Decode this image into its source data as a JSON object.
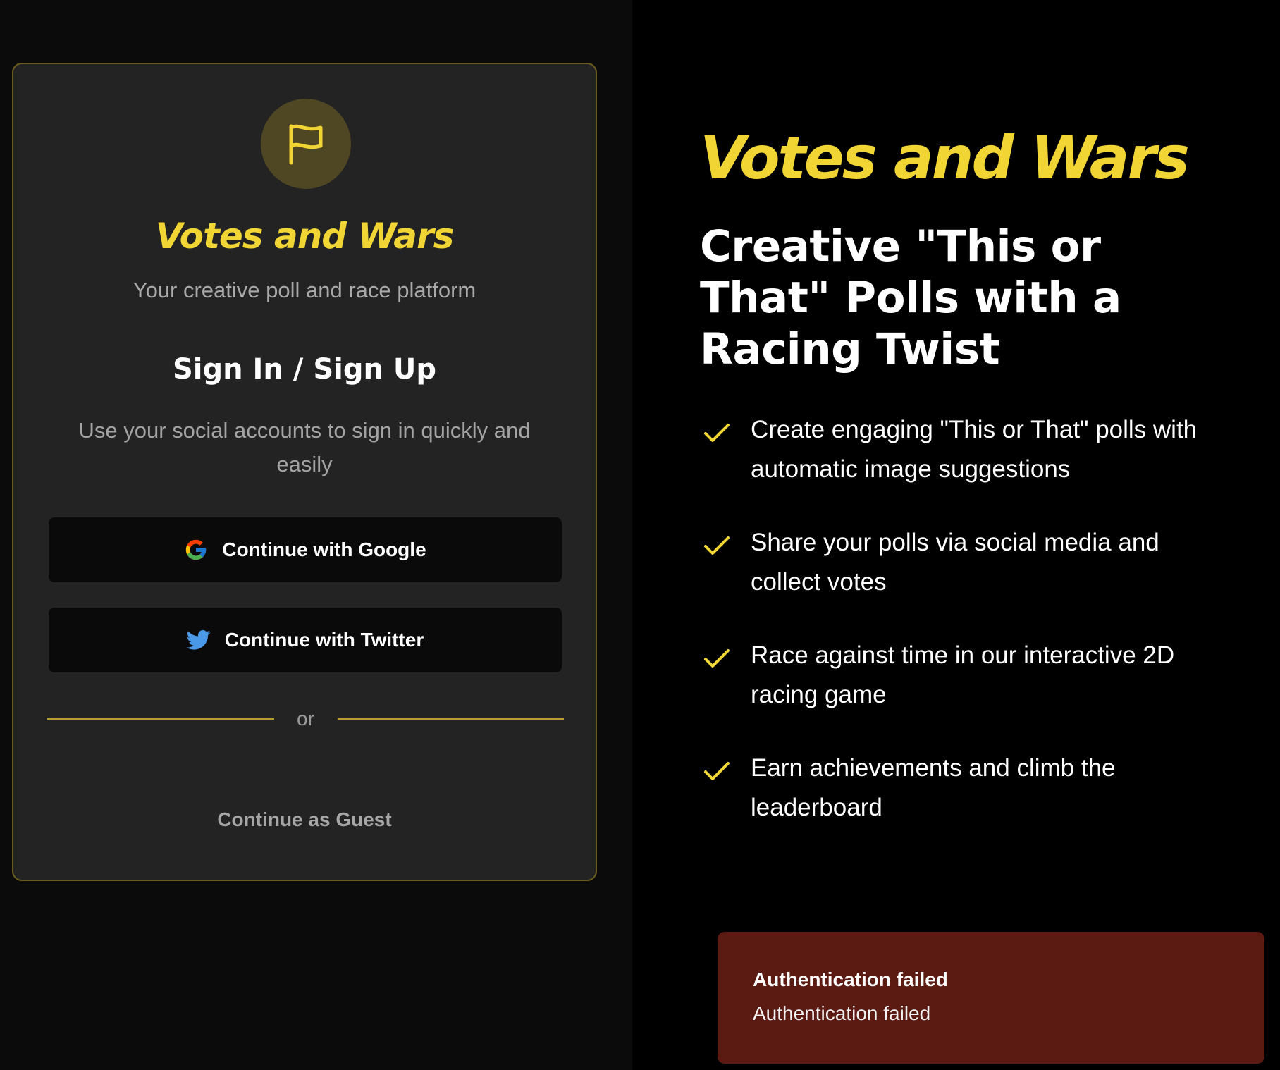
{
  "app": {
    "brand_name": "Votes and Wars",
    "accent_color": "#f0d535"
  },
  "auth_card": {
    "logo_icon": "flag-icon",
    "brand_name": "Votes and Wars",
    "tagline": "Your creative poll and race platform",
    "title": "Sign In / Sign Up",
    "subtitle": "Use your social accounts to sign in quickly and easily",
    "google_button": {
      "label": "Continue with Google",
      "icon": "google-icon"
    },
    "twitter_button": {
      "label": "Continue with Twitter",
      "icon": "twitter-icon"
    },
    "divider_text": "or",
    "guest_link": "Continue as Guest"
  },
  "hero": {
    "brand_name": "Votes and Wars",
    "headline": "Creative \"This or That\" Polls with a Racing Twist",
    "features": [
      "Create engaging \"This or That\" polls with automatic image suggestions",
      "Share your polls via social media and collect votes",
      "Race against time in our interactive 2D racing game",
      "Earn achievements and climb the leaderboard"
    ]
  },
  "toast": {
    "title": "Authentication failed",
    "message": "Authentication failed",
    "background_color": "#5b1b12"
  }
}
